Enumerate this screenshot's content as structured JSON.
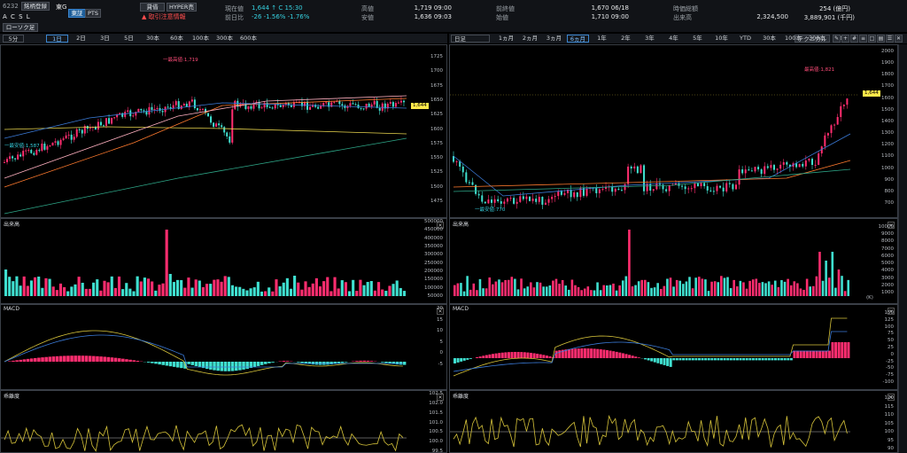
{
  "header": {
    "code": "6232",
    "symbol": "A C S L",
    "watch_button": "銘柄登録",
    "market": "東G",
    "exchange_tabs": [
      "東証",
      "PTS"
    ],
    "credit_button": "貸借",
    "hyper_button": "HYPER売",
    "warning": "取引注意情報",
    "fields": [
      {
        "label": "現在値",
        "value": "1,644 ↑  C 15:30"
      },
      {
        "label": "前日比",
        "value": "-26   -1.56%   -1.76%"
      },
      {
        "label": "高値",
        "value": "1,719 09:00"
      },
      {
        "label": "安値",
        "value": "1,636 09:03"
      },
      {
        "label": "前終値",
        "value": "1,670 06/18"
      },
      {
        "label": "始値",
        "value": "1,710 09:00"
      },
      {
        "label": "時価総額",
        "value": "254 (億円)"
      },
      {
        "label": "出来高",
        "value": "2,324,500"
      },
      {
        "label": "",
        "value": "3,889,901 (千円)"
      }
    ],
    "chart_type_select": "ローソク足"
  },
  "left_toolbar": {
    "interval_select": "5分",
    "periods": [
      "1日",
      "2日",
      "3日",
      "5日",
      "30本",
      "60本",
      "100本",
      "300本",
      "600本"
    ],
    "active": "1日"
  },
  "right_toolbar": {
    "interval_select": "日足",
    "periods": [
      "1ヵ月",
      "2ヵ月",
      "3ヵ月",
      "6ヵ月",
      "1年",
      "2年",
      "3年",
      "4年",
      "5年",
      "10年",
      "YTD",
      "30本",
      "100本",
      "300本",
      "600本"
    ],
    "active": "6ヵ月",
    "technical_button": "テクニカル",
    "tools": [
      "pencil-icon",
      "crosshair-icon",
      "grid-icon",
      "list-icon",
      "window-icon",
      "layout-icon",
      "menu-icon",
      "close-icon"
    ]
  },
  "left_price": {
    "axis": [
      "1725",
      "1700",
      "1675",
      "1650",
      "1625",
      "1600",
      "1575",
      "1550",
      "1525",
      "1500",
      "1475"
    ],
    "current_badge": "1,644",
    "high_note": "一最高値:1,719",
    "low_note": "一最安値:1,587"
  },
  "right_price": {
    "axis": [
      "2000",
      "1900",
      "1800",
      "1700",
      "1600",
      "1500",
      "1400",
      "1300",
      "1200",
      "1100",
      "1000",
      "900",
      "800",
      "700"
    ],
    "current_badge": "1,644",
    "high_note": "最高値:1,821",
    "low_note": "一最安値:770"
  },
  "left_volume": {
    "label": "出来高",
    "axis": [
      "500000",
      "450000",
      "400000",
      "350000",
      "300000",
      "250000",
      "200000",
      "150000",
      "100000",
      "50000"
    ]
  },
  "right_volume": {
    "label": "出来高",
    "axis": [
      "10000",
      "9000",
      "8000",
      "7000",
      "6000",
      "5000",
      "4000",
      "3000",
      "2000",
      "1000"
    ],
    "unit": "(K)"
  },
  "left_macd": {
    "label": "MACD",
    "axis": [
      "20",
      "15",
      "10",
      "5",
      "0",
      "-5"
    ]
  },
  "right_macd": {
    "label": "MACD",
    "axis": [
      "150",
      "125",
      "100",
      "75",
      "50",
      "25",
      "0",
      "-25",
      "-50",
      "-75",
      "-100"
    ]
  },
  "left_kairi": {
    "label": "乖離度",
    "axis": [
      "102.5",
      "102.0",
      "101.5",
      "101.0",
      "100.5",
      "100.0",
      "99.5"
    ]
  },
  "right_kairi": {
    "label": "乖離度",
    "axis": [
      "120",
      "115",
      "110",
      "105",
      "100",
      "95",
      "90"
    ]
  },
  "colors": {
    "up": "#ff2d6f",
    "down": "#3fe0d0",
    "macd": "#d7c43a",
    "signal": "#3b7bd8",
    "ma_short": "#e8d44d",
    "ma_mid": "#ff7a2e",
    "ma_long": "#2ea889"
  }
}
